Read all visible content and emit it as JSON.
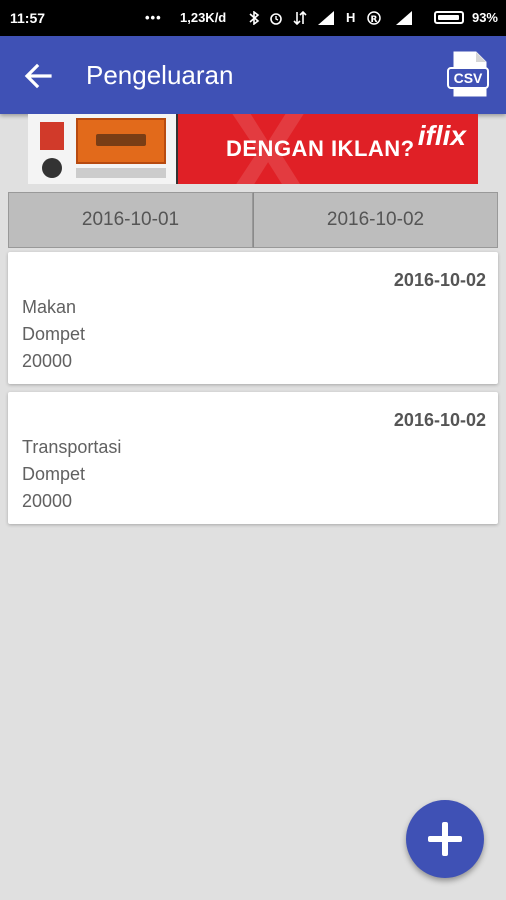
{
  "status_bar": {
    "time": "11:57",
    "network_speed": "1,23K/d",
    "icons": [
      "notification-dots-icon",
      "bluetooth-icon",
      "alarm-icon",
      "data-icon",
      "signal-icon",
      "h-network-icon",
      "roaming-r-icon",
      "signal-icon",
      "battery-icon"
    ],
    "network_type": "H",
    "battery_percent": "93%"
  },
  "app_bar": {
    "title": "Pengeluaran",
    "back_icon": "arrow-back-icon",
    "export_icon": "csv-icon",
    "export_label": "CSV",
    "color": "#3f51b5"
  },
  "ad_banner": {
    "text": "DENGAN IKLAN?",
    "brand": "iflix",
    "color": "#e02026"
  },
  "date_tabs": [
    {
      "label": "2016-10-01"
    },
    {
      "label": "2016-10-02"
    }
  ],
  "expenses": [
    {
      "date": "2016-10-02",
      "category": "Makan",
      "account": "Dompet",
      "amount": "20000"
    },
    {
      "date": "2016-10-02",
      "category": "Transportasi",
      "account": "Dompet",
      "amount": "20000"
    }
  ],
  "fab": {
    "icon": "plus-icon"
  }
}
